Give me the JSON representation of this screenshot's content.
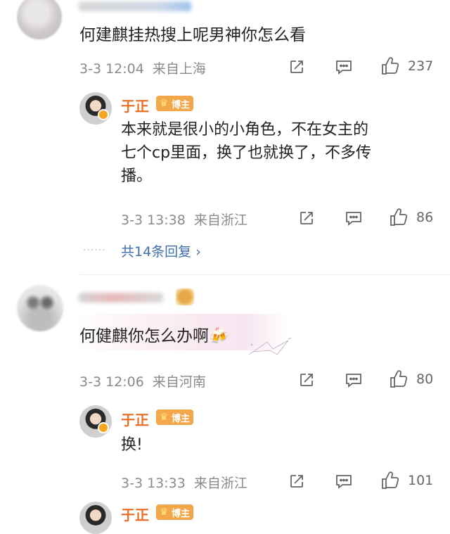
{
  "comments": [
    {
      "text": "何建麒挂热搜上呢男神你怎么看",
      "date": "3-3 12:04",
      "location": "来自上海",
      "likes": "237",
      "reply": {
        "author": "于正",
        "badge": "博主",
        "text_line1": "本来就是很小的小角色，不在女主的",
        "text_line2": "七个cp里面，换了也就换了，不多传",
        "text_line3": "播。",
        "date": "3-3 13:38",
        "location": "来自浙江",
        "likes": "86"
      },
      "more_replies": "共14条回复 ›"
    },
    {
      "text": "何健麒你怎么办啊🍻",
      "date": "3-3 12:06",
      "location": "来自河南",
      "likes": "80",
      "reply": {
        "author": "于正",
        "badge": "博主",
        "text": "换!",
        "date": "3-3 13:33",
        "location": "来自浙江",
        "likes": "101"
      }
    }
  ],
  "partial_reply": {
    "author": "于正",
    "badge": "博主"
  },
  "colors": {
    "name": "#e8702a",
    "badge": "#f2a84a",
    "link": "#3f6fa8",
    "meta": "#8a8a8a"
  },
  "icons": [
    "share-icon",
    "comment-icon",
    "like-icon",
    "crown-icon",
    "vip-badge-icon"
  ]
}
